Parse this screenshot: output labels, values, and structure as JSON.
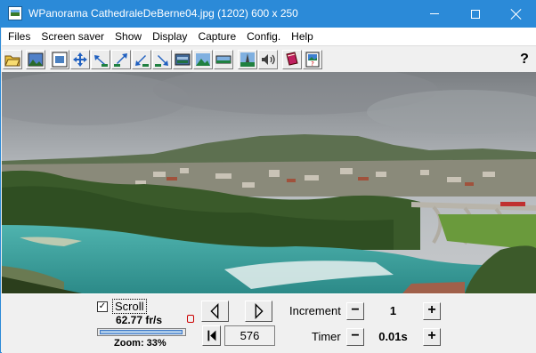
{
  "window": {
    "title": "WPanorama  CathedraleDeBerne04.jpg  (1202) 600 x 250"
  },
  "menu": {
    "items": [
      "Files",
      "Screen saver",
      "Show",
      "Display",
      "Capture",
      "Config.",
      "Help"
    ]
  },
  "toolbar": {
    "tools": [
      "open-file-icon",
      "image-icon",
      "fit-window-icon",
      "expand-arrows-icon",
      "arrow-left-down-icon",
      "arrow-up-right-icon",
      "arrow-down-left-icon",
      "arrow-down-right-icon",
      "panorama-view-icon",
      "landscape-icon",
      "flat-view-icon",
      "tower-icon",
      "sound-icon",
      "book-icon",
      "slideshow-icon"
    ],
    "help_label": "?"
  },
  "controls": {
    "scroll_checked": true,
    "scroll_check_glyph": "✓",
    "scroll_label": "Scroll",
    "fps_text": "62.77 fr/s",
    "zoom_percent": 33,
    "zoom_text": "Zoom: 33%",
    "frame_value": "576",
    "increment_label": "Increment",
    "increment_value": "1",
    "timer_label": "Timer",
    "timer_value": "0.01s",
    "minus_glyph": "−",
    "plus_glyph": "+"
  },
  "colors": {
    "titlebar": "#2b8ad8",
    "sky": "#a9adb1",
    "river": "#3fa7a4",
    "forest": "#3d5a2c"
  }
}
